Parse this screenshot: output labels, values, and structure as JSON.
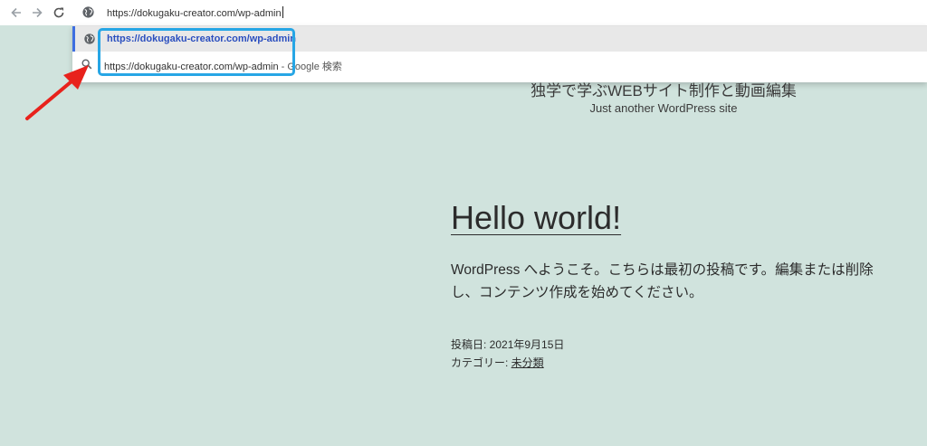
{
  "browser": {
    "address_bar_value": "https://dokugaku-creator.com/wp-admin",
    "suggestions": [
      {
        "text": "https://dokugaku-creator.com/wp-admin",
        "suffix": ""
      },
      {
        "text": "https://dokugaku-creator.com/wp-admin",
        "suffix": " - Google 検索"
      }
    ]
  },
  "site": {
    "title": "独学で学ぶWEBサイト制作と動画編集",
    "tagline": "Just another WordPress site"
  },
  "post": {
    "title": "Hello world!",
    "excerpt": "WordPress へようこそ。こちらは最初の投稿です。編集または削除し、コンテンツ作成を始めてください。",
    "date_label": "投稿日: 2021年9月15日",
    "category_label": "カテゴリー: ",
    "category": "未分類"
  },
  "colors": {
    "page_background": "#d0e3dd",
    "highlight_border": "#27a6e5",
    "annotation_arrow": "#e8221c"
  },
  "icons": [
    "back-arrow-icon",
    "forward-arrow-icon",
    "reload-icon",
    "globe-icon",
    "search-icon"
  ]
}
